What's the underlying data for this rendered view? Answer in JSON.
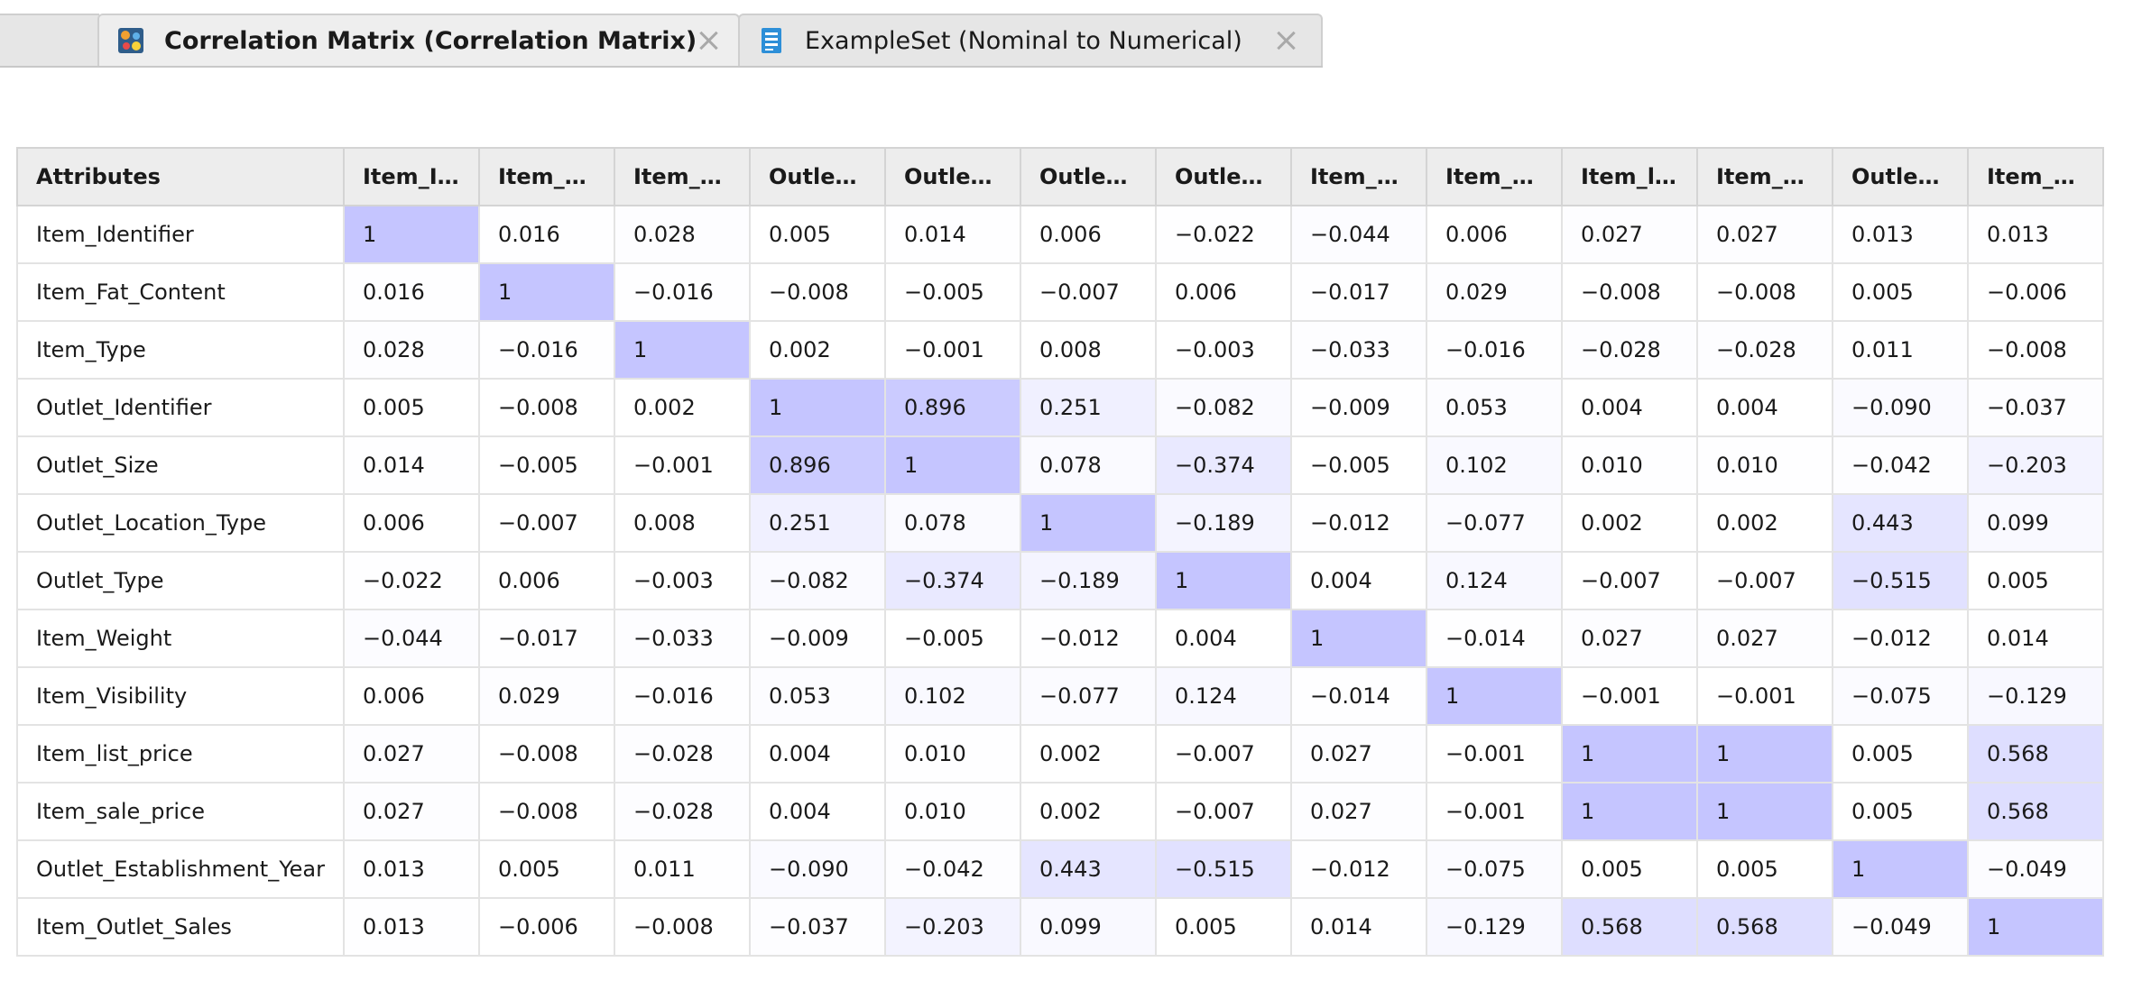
{
  "tabs": [
    {
      "label": "Correlation Matrix (Correlation Matrix)",
      "active": true,
      "icon": "correlation-matrix-icon"
    },
    {
      "label": "ExampleSet (Nominal to Numerical)",
      "active": false,
      "icon": "exampleset-icon"
    }
  ],
  "colors": {
    "highlight_rgb": [
      197,
      197,
      255
    ],
    "accent": "#7b68ee"
  },
  "matrix": {
    "header_first": "Attributes",
    "columns": [
      "Item_Id...",
      "Item_F...",
      "Item_T...",
      "Outlet_...",
      "Outlet_...",
      "Outlet_...",
      "Outlet_...",
      "Item_W...",
      "Item_Vi...",
      "Item_li...",
      "Item_s...",
      "Outlet_...",
      "Item_O..."
    ],
    "rows": [
      {
        "name": "Item_Identifier",
        "values": [
          "1",
          "0.016",
          "0.028",
          "0.005",
          "0.014",
          "0.006",
          "−0.022",
          "−0.044",
          "0.006",
          "0.027",
          "0.027",
          "0.013",
          "0.013"
        ]
      },
      {
        "name": "Item_Fat_Content",
        "values": [
          "0.016",
          "1",
          "−0.016",
          "−0.008",
          "−0.005",
          "−0.007",
          "0.006",
          "−0.017",
          "0.029",
          "−0.008",
          "−0.008",
          "0.005",
          "−0.006"
        ]
      },
      {
        "name": "Item_Type",
        "values": [
          "0.028",
          "−0.016",
          "1",
          "0.002",
          "−0.001",
          "0.008",
          "−0.003",
          "−0.033",
          "−0.016",
          "−0.028",
          "−0.028",
          "0.011",
          "−0.008"
        ]
      },
      {
        "name": "Outlet_Identifier",
        "values": [
          "0.005",
          "−0.008",
          "0.002",
          "1",
          "0.896",
          "0.251",
          "−0.082",
          "−0.009",
          "0.053",
          "0.004",
          "0.004",
          "−0.090",
          "−0.037"
        ]
      },
      {
        "name": "Outlet_Size",
        "values": [
          "0.014",
          "−0.005",
          "−0.001",
          "0.896",
          "1",
          "0.078",
          "−0.374",
          "−0.005",
          "0.102",
          "0.010",
          "0.010",
          "−0.042",
          "−0.203"
        ]
      },
      {
        "name": "Outlet_Location_Type",
        "values": [
          "0.006",
          "−0.007",
          "0.008",
          "0.251",
          "0.078",
          "1",
          "−0.189",
          "−0.012",
          "−0.077",
          "0.002",
          "0.002",
          "0.443",
          "0.099"
        ]
      },
      {
        "name": "Outlet_Type",
        "values": [
          "−0.022",
          "0.006",
          "−0.003",
          "−0.082",
          "−0.374",
          "−0.189",
          "1",
          "0.004",
          "0.124",
          "−0.007",
          "−0.007",
          "−0.515",
          "0.005"
        ]
      },
      {
        "name": "Item_Weight",
        "values": [
          "−0.044",
          "−0.017",
          "−0.033",
          "−0.009",
          "−0.005",
          "−0.012",
          "0.004",
          "1",
          "−0.014",
          "0.027",
          "0.027",
          "−0.012",
          "0.014"
        ]
      },
      {
        "name": "Item_Visibility",
        "values": [
          "0.006",
          "0.029",
          "−0.016",
          "0.053",
          "0.102",
          "−0.077",
          "0.124",
          "−0.014",
          "1",
          "−0.001",
          "−0.001",
          "−0.075",
          "−0.129"
        ]
      },
      {
        "name": "Item_list_price",
        "values": [
          "0.027",
          "−0.008",
          "−0.028",
          "0.004",
          "0.010",
          "0.002",
          "−0.007",
          "0.027",
          "−0.001",
          "1",
          "1",
          "0.005",
          "0.568"
        ]
      },
      {
        "name": "Item_sale_price",
        "values": [
          "0.027",
          "−0.008",
          "−0.028",
          "0.004",
          "0.010",
          "0.002",
          "−0.007",
          "0.027",
          "−0.001",
          "1",
          "1",
          "0.005",
          "0.568"
        ]
      },
      {
        "name": "Outlet_Establishment_Year",
        "values": [
          "0.013",
          "0.005",
          "0.011",
          "−0.090",
          "−0.042",
          "0.443",
          "−0.515",
          "−0.012",
          "−0.075",
          "0.005",
          "0.005",
          "1",
          "−0.049"
        ]
      },
      {
        "name": "Item_Outlet_Sales",
        "values": [
          "0.013",
          "−0.006",
          "−0.008",
          "−0.037",
          "−0.203",
          "0.099",
          "0.005",
          "0.014",
          "−0.129",
          "0.568",
          "0.568",
          "−0.049",
          "1"
        ]
      }
    ]
  }
}
